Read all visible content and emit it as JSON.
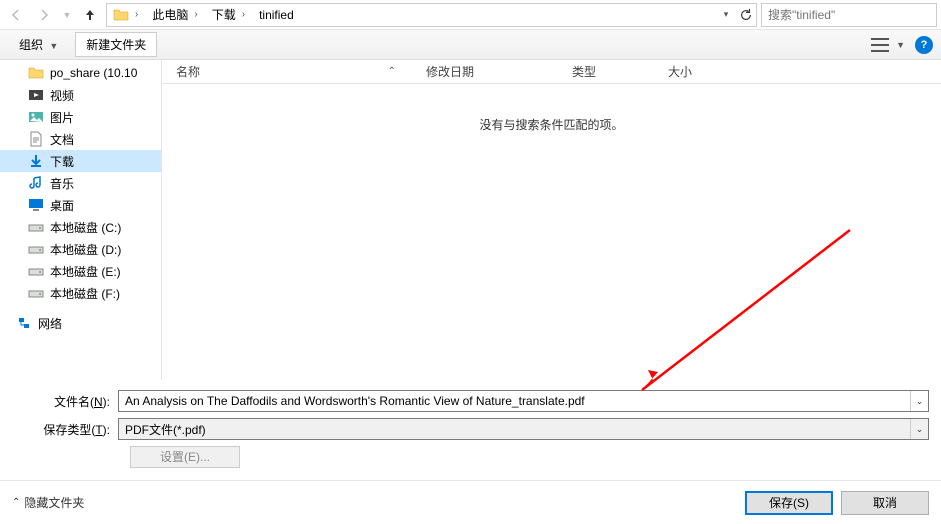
{
  "nav": {
    "breadcrumb": [
      "此电脑",
      "下载",
      "tinified"
    ],
    "search_placeholder": "搜索\"tinified\""
  },
  "toolbar": {
    "organize": "组织",
    "new_folder": "新建文件夹"
  },
  "sidebar": {
    "items": [
      {
        "label": "po_share (10.10",
        "icon": "folder"
      },
      {
        "label": "视频",
        "icon": "video"
      },
      {
        "label": "图片",
        "icon": "image"
      },
      {
        "label": "文档",
        "icon": "doc"
      },
      {
        "label": "下载",
        "icon": "download",
        "selected": true
      },
      {
        "label": "音乐",
        "icon": "music"
      },
      {
        "label": "桌面",
        "icon": "desktop"
      },
      {
        "label": "本地磁盘 (C:)",
        "icon": "drive"
      },
      {
        "label": "本地磁盘 (D:)",
        "icon": "drive"
      },
      {
        "label": "本地磁盘 (E:)",
        "icon": "drive"
      },
      {
        "label": "本地磁盘 (F:)",
        "icon": "drive"
      }
    ],
    "network": "网络"
  },
  "columns": {
    "name": "名称",
    "date": "修改日期",
    "type": "类型",
    "size": "大小"
  },
  "empty_message": "没有与搜索条件匹配的项。",
  "fields": {
    "filename_label_pre": "文件名(",
    "filename_label_key": "N",
    "filename_label_post": "):",
    "filename_value": "An Analysis on The Daffodils and Wordsworth's Romantic View of Nature_translate.pdf",
    "filetype_label_pre": "保存类型(",
    "filetype_label_key": "T",
    "filetype_label_post": "):",
    "filetype_value": "PDF文件(*.pdf)",
    "settings_label": "设置(E)..."
  },
  "footer": {
    "hide_folders": "隐藏文件夹",
    "save": "保存(S)",
    "cancel": "取消"
  }
}
